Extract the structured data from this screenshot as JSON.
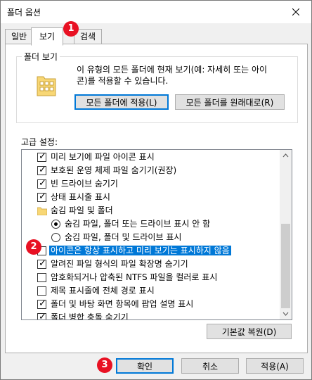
{
  "window": {
    "title": "폴더 옵션"
  },
  "tabs": [
    {
      "label": "일반"
    },
    {
      "label": "보기"
    },
    {
      "label": "검색"
    }
  ],
  "folder_views": {
    "title": "폴더 보기",
    "description_line1": "이 유형의 모든 폴더에 현재 보기(예: 자세히 또는 아이",
    "description_line2": "콘)를 적용할 수 있습니다.",
    "apply_button": "모든 폴더에 적용(L)",
    "reset_button": "모든 폴더를 원래대로(R)"
  },
  "advanced": {
    "label": "고급 설정:",
    "items": [
      {
        "text": "미리 보기에 파일 아이콘 표시",
        "kind": "checkbox",
        "checked": true
      },
      {
        "text": "보호된 운영 체제 파일 숨기기(권장)",
        "kind": "checkbox",
        "checked": true
      },
      {
        "text": "빈 드라이브 숨기기",
        "kind": "checkbox",
        "checked": true
      },
      {
        "text": "상태 표시줄 표시",
        "kind": "checkbox",
        "checked": true
      },
      {
        "text": "숨김 파일 및 폴더",
        "kind": "folder"
      },
      {
        "text": "숨김 파일, 폴더 또는 드라이브 표시 안 함",
        "kind": "radio",
        "checked": true
      },
      {
        "text": "숨김 파일, 폴더 및 드라이브 표시",
        "kind": "radio",
        "checked": false
      },
      {
        "text": "아이콘은 항상 표시하고 미리 보기는 표시하지 않음",
        "kind": "checkbox",
        "checked": false,
        "selected": true
      },
      {
        "text": "알려진 파일 형식의 파일 확장명 숨기기",
        "kind": "checkbox",
        "checked": true
      },
      {
        "text": "암호화되거나 압축된 NTFS 파일을 컬러로 표시",
        "kind": "checkbox",
        "checked": false
      },
      {
        "text": "제목 표시줄에 전체 경로 표시",
        "kind": "checkbox",
        "checked": false
      },
      {
        "text": "폴더 및 바탕 화면 항목에 팝업 설명 표시",
        "kind": "checkbox",
        "checked": true
      },
      {
        "text": "폴더 병합 충돌 숨기기",
        "kind": "checkbox",
        "checked": true
      }
    ],
    "restore_button": "기본값 복원(D)"
  },
  "footer": {
    "ok": "확인",
    "cancel": "취소",
    "apply": "적용(A)"
  },
  "markers": [
    "1",
    "2",
    "3"
  ],
  "colors": {
    "accent": "#0078d7",
    "marker": "#e81123"
  }
}
